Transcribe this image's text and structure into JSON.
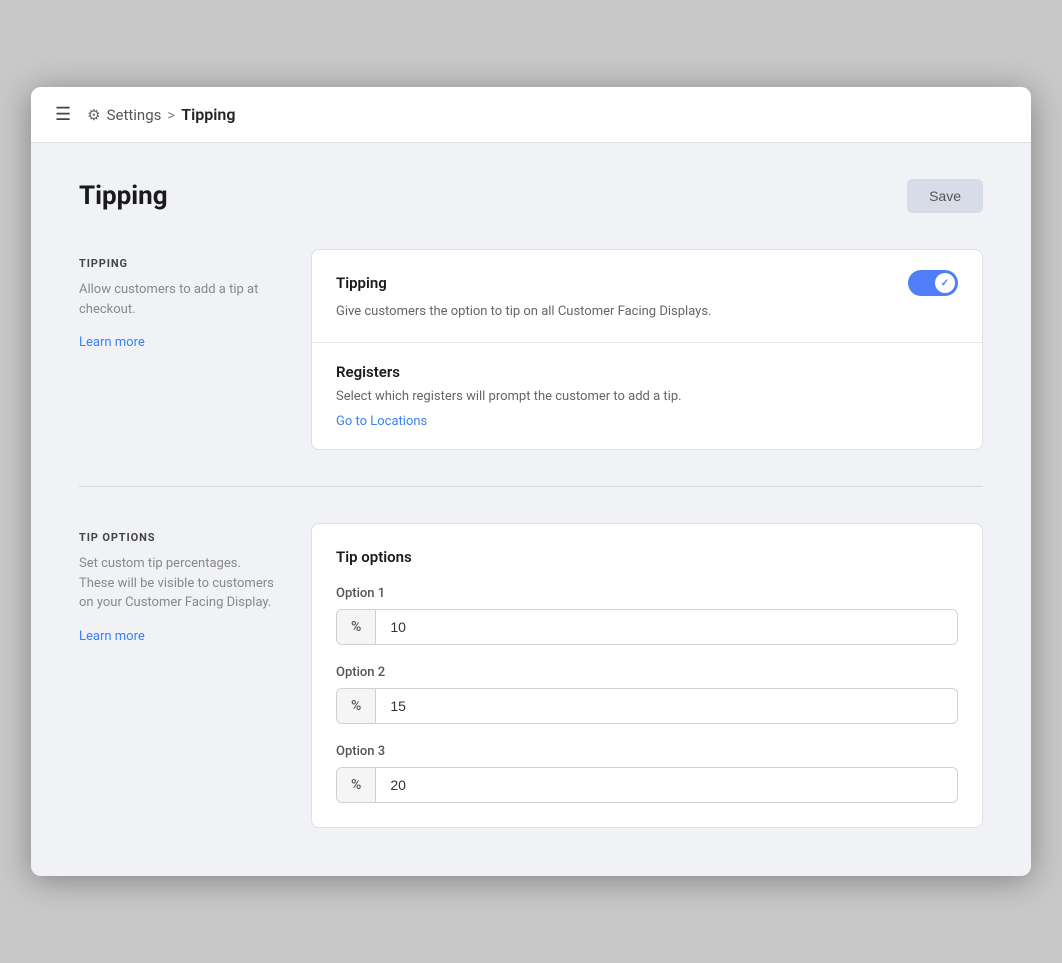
{
  "topbar": {
    "settings_label": "Settings",
    "separator": ">",
    "current_page": "Tipping"
  },
  "page": {
    "title": "Tipping",
    "save_button": "Save"
  },
  "tipping_section": {
    "label_title": "TIPPING",
    "label_desc": "Allow customers to add a tip at checkout.",
    "learn_more": "Learn more",
    "card": {
      "tipping_row": {
        "title": "Tipping",
        "desc": "Give customers the option to tip on all Customer Facing Displays.",
        "toggle_on": true
      },
      "registers_row": {
        "title": "Registers",
        "desc": "Select which registers will prompt the customer to add a tip.",
        "link": "Go to Locations"
      }
    }
  },
  "tip_options_section": {
    "label_title": "TIP OPTIONS",
    "label_desc": "Set custom tip percentages. These will be visible to customers on your Customer Facing Display.",
    "learn_more": "Learn more",
    "card": {
      "title": "Tip options",
      "option1": {
        "label": "Option 1",
        "prefix": "%",
        "value": "10"
      },
      "option2": {
        "label": "Option 2",
        "prefix": "%",
        "value": "15"
      },
      "option3": {
        "label": "Option 3",
        "prefix": "%",
        "value": "20"
      }
    }
  }
}
